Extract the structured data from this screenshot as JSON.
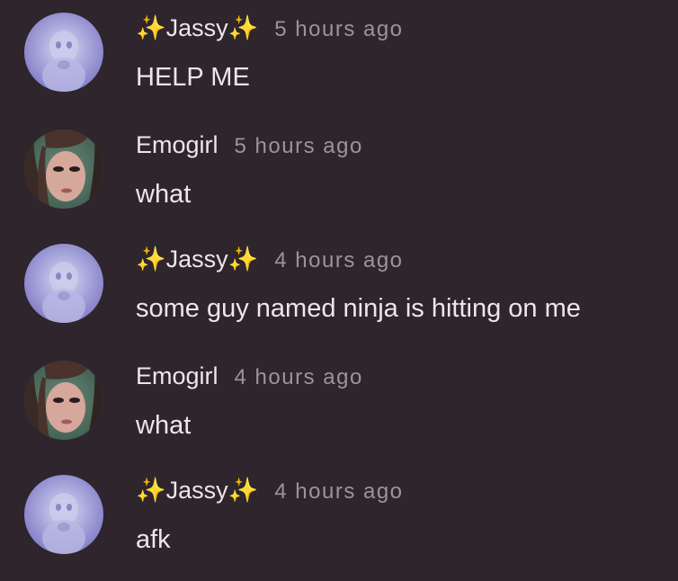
{
  "messages": [
    {
      "username": "✨Jassy✨",
      "time": "5 hours ago",
      "text": "HELP ME",
      "avatar": "jassy-avatar"
    },
    {
      "username": "Emogirl",
      "time": "5 hours ago",
      "text": "what",
      "avatar": "emogirl-avatar"
    },
    {
      "username": "✨Jassy✨",
      "time": "4 hours ago",
      "text": "some guy named ninja is hitting on me",
      "avatar": "jassy-avatar"
    },
    {
      "username": "Emogirl",
      "time": "4 hours ago",
      "text": "what",
      "avatar": "emogirl-avatar"
    },
    {
      "username": "✨Jassy✨",
      "time": "4 hours ago",
      "text": "afk",
      "avatar": "jassy-avatar"
    }
  ],
  "colors": {
    "background": "#2e252d",
    "username": "#ede6ea",
    "timestamp": "#9d939c",
    "text": "#ede6ea"
  }
}
